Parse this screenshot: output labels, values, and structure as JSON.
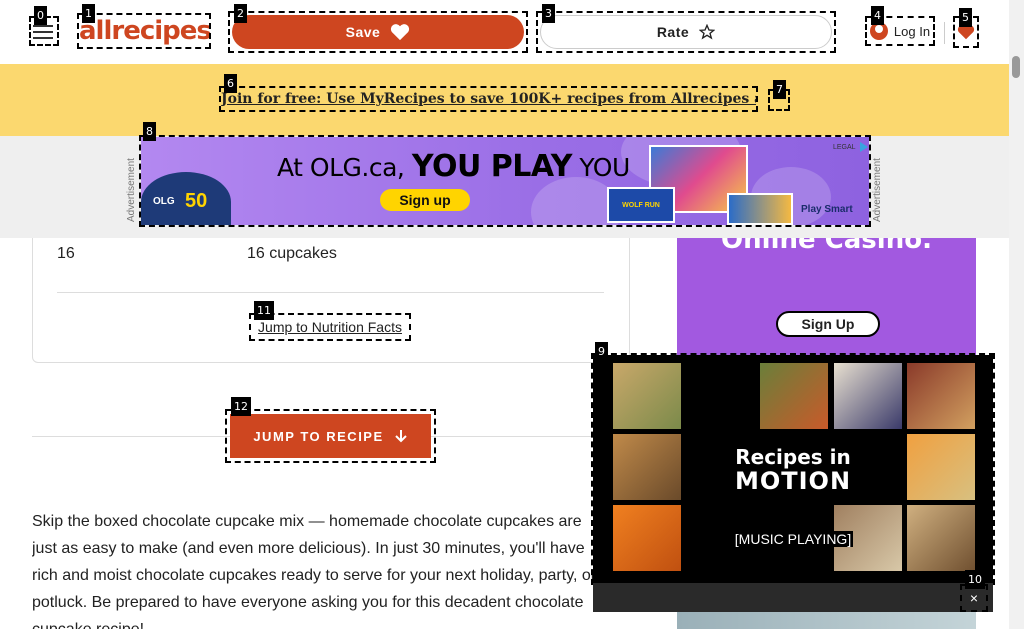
{
  "header": {
    "logo_text": "allrecipes",
    "save_label": "Save",
    "rate_label": "Rate",
    "login_label": "Log In"
  },
  "promo": {
    "link_text": "Join for free: Use MyRecipes to save 100K+ recipes from Allrecipes and more"
  },
  "ad_top": {
    "label": "Advertisement",
    "headline_pre": "At OLG.ca,",
    "headline_bold": "YOU PLAY",
    "headline_post": "YOU",
    "signup": "Sign up",
    "brand_number": "50",
    "brand_logo": "OLG",
    "game1": "WOLF RUN",
    "partner": "Play Smart",
    "legal": "LEGAL"
  },
  "recipe_info": {
    "servings_value": "16",
    "yield_value": "16 cupcakes",
    "nutrition_link": "Jump to Nutrition Facts"
  },
  "jump_button": {
    "label": "JUMP TO RECIPE"
  },
  "intro": {
    "text": "Skip the boxed chocolate cupcake mix — homemade chocolate cupcakes are just as easy to make (and even more delicious). In just 30 minutes, you'll have rich and moist chocolate cupcakes ready to serve for your next holiday, party, or potluck. Be prepared to have everyone asking you for this decadent chocolate cupcake recipe!"
  },
  "side_ad": {
    "title": "Online Casino.",
    "signup": "Sign Up"
  },
  "video": {
    "title_line1": "Recipes in",
    "title_line2": "MOTION",
    "caption": "[MUSIC PLAYING]"
  },
  "markers": [
    "0",
    "1",
    "2",
    "3",
    "4",
    "5",
    "6",
    "7",
    "8",
    "9",
    "10",
    "11",
    "12"
  ],
  "colors": {
    "brand": "#ce4620",
    "promo_bg": "#fbd86f",
    "ad_purple": "#a259e0"
  }
}
